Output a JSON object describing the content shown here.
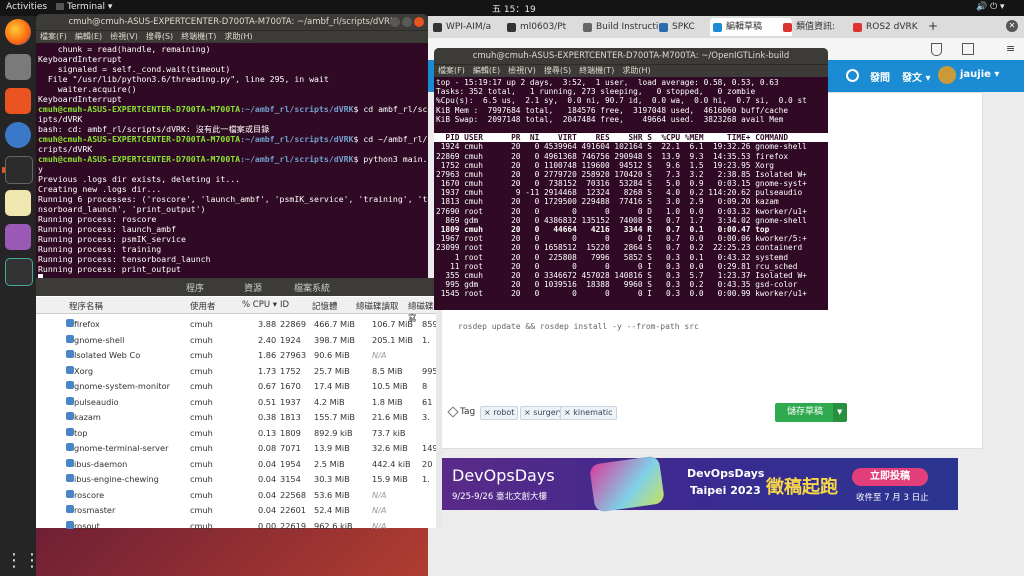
{
  "topbar": {
    "activities": "Activities",
    "app": "Terminal ▾",
    "clock": "五 15：19",
    "sys": "🔊 ⏻ ▾"
  },
  "dock": {
    "icons": [
      "firefox-icon",
      "files-icon",
      "software-icon",
      "help-icon",
      "terminal-icon",
      "editor-icon",
      "video-icon",
      "system-monitor-icon",
      "apps-grid-icon"
    ]
  },
  "browser": {
    "tabs": [
      "WPI-AIM/a",
      "ml0603/Pt",
      "Build Instructio",
      "SPKC",
      "編輯草稿",
      "類值資訊:",
      "ROS2 dVRK"
    ],
    "header": {
      "post": "發問",
      "publish": "發文 ▾",
      "user": "jaujie ▾"
    },
    "tags_label": "Tag",
    "tags": [
      "robot",
      "surgery",
      "kinematic"
    ],
    "save_label": "儲存草稿",
    "partial_text": "rosdep update && rosdep install -y --from-path src"
  },
  "banner": {
    "title": "DevOpsDays",
    "dates": "9/25-9/26 臺北文創大樓",
    "city": "DevOpsDays\nTaipei 2023",
    "city1": "DevOpsDays",
    "city2": "Taipei 2023",
    "cta": "徵稿起跑",
    "button": "立即投稿",
    "deadline": "收件至 7 月 3 日止"
  },
  "term1": {
    "title": "cmuh@cmuh-ASUS-EXPERTCENTER-D700TA-M700TA: ~/ambf_rl/scripts/dVRK",
    "menu": [
      "檔案(F)",
      "編輯(E)",
      "檢視(V)",
      "搜尋(S)",
      "終端機(T)",
      "求助(H)"
    ],
    "lines": [
      "    chunk = read(handle, remaining)",
      "KeyboardInterrupt",
      "    signaled = self._cond.wait(timeout)",
      "  File \"/usr/lib/python3.6/threading.py\", line 295, in wait",
      "    waiter.acquire()",
      "KeyboardInterrupt"
    ],
    "p1_user": "cmuh@cmuh-ASUS-EXPERTCENTER-D700TA-M700TA",
    "p1_path": ":~/ambf_rl/scripts/dVRK",
    "p1_cmd": "$ cd ambf_rl/scr",
    "p1_wrap": "ipts/dVRK",
    "err": "bash: cd: ambf_rl/scripts/dVRK: 沒有此一檔案或目錄",
    "p2_cmd": "$ cd ~/ambf_rl/s",
    "p2_wrap": "cripts/dVRK",
    "p3_cmd": "$ python3 main.p",
    "p3_wrap": "y",
    "out": [
      "Previous .logs dir exists, deleting it...",
      "Creating new .logs dir...",
      "Running 6 processes: ('roscore', 'launch_ambf', 'psmIK_service', 'training', 'te",
      "nsorboard_launch', 'print_output')",
      "Running process: roscore",
      "Running process: launch_ambf",
      "Running process: psmIK_service",
      "Running process: training",
      "Running process: tensorboard_launch",
      "Running process: print_output"
    ]
  },
  "term2": {
    "title": "cmuh@cmuh-ASUS-EXPERTCENTER-D700TA-M700TA: ~/OpenIGTLink-build",
    "menu": [
      "檔案(F)",
      "編輯(E)",
      "檢視(V)",
      "搜尋(S)",
      "終端機(T)",
      "求助(H)"
    ],
    "summary": [
      "top - 15:19:17 up 2 days,  3:52,  1 user,  load average: 0.58, 0.53, 0.63",
      "Tasks: 352 total,   1 running, 273 sleeping,   0 stopped,   0 zombie",
      "%Cpu(s):  6.5 us,  2.1 sy,  0.0 ni, 90.7 id,  0.0 wa,  0.0 hi,  0.7 si,  0.0 st",
      "KiB Mem :  7997684 total,   184576 free,  3197048 used,  4616060 buff/cache",
      "KiB Swap:  2097148 total,  2047484 free,    49664 used.  3823268 avail Mem"
    ],
    "header": "  PID USER      PR  NI    VIRT    RES    SHR S  %CPU %MEM     TIME+ COMMAND",
    "rows": [
      " 1924 cmuh      20   0 4539964 491604 102164 S  22.1  6.1  19:32.26 gnome-shell",
      "22869 cmuh      20   0 4961368 746756 290948 S  13.9  9.3  14:35.53 firefox",
      " 1752 cmuh      20   0 1100748 119600  94512 S   9.6  1.5  19:23.95 Xorg",
      "27963 cmuh      20   0 2779720 258920 170420 S   7.3  3.2   2:38.85 Isolated W+",
      " 1670 cmuh      20   0  738152  70316  53284 S   5.0  0.9   0:03.15 gnome-syst+",
      " 1937 cmuh       9 -11 2914468  12324   8268 S   4.0  0.2 114:20.62 pulseaudio",
      " 1813 cmuh      20   0 1729500 229488  77416 S   3.0  2.9   0:09.20 kazam",
      "27690 root      20   0       0      0      0 D   1.0  0.0   0:03.32 kworker/u1+",
      "  869 gdm       20   0 4386832 135152  74008 S   0.7  1.7   3:34.02 gnome-shell",
      " 1809 cmuh      20   0   44664   4216   3344 R   0.7  0.1   0:00.47 top",
      " 1967 root      20   0       0      0      0 I   0.7  0.0   0:00.06 kworker/5:+",
      "23099 root      20   0 1658512  15220   2864 S   0.7  0.2  22:25.23 containerd",
      "    1 root      20   0  225808   7996   5852 S   0.3  0.1   0:43.32 systemd",
      "   11 root      20   0       0      0      0 I   0.3  0.0   0:29.81 rcu_sched",
      "  355 cmuh      20   0 3346672 457028 140816 S   0.3  5.7   1:23.37 Isolated W+",
      "  995 gdm       20   0 1039516  18388   9960 S   0.3  0.2   0:43.35 gsd-color",
      " 1545 root      20   0       0      0      0 I   0.3  0.0   0:00.99 kworker/u1+"
    ],
    "bold_row_index": 9
  },
  "sysmon": {
    "tabs": [
      "程序",
      "資源",
      "檔案系統"
    ],
    "headers": [
      "程序名稱",
      "使用者",
      "% CPU ▾",
      "ID",
      "記憶體",
      "總磁碟讀取",
      "總磁碟寫"
    ],
    "rows": [
      {
        "name": "firefox",
        "user": "cmuh",
        "cpu": "3.88",
        "id": "22869",
        "mem": "466.7 MiB",
        "read": "106.7 MiB",
        "write": "859."
      },
      {
        "name": "gnome-shell",
        "user": "cmuh",
        "cpu": "2.40",
        "id": "1924",
        "mem": "398.7 MiB",
        "read": "205.1 MiB",
        "write": "1."
      },
      {
        "name": "Isolated Web Co",
        "user": "cmuh",
        "cpu": "1.86",
        "id": "27963",
        "mem": "90.6 MiB",
        "read": "N/A",
        "write": ""
      },
      {
        "name": "Xorg",
        "user": "cmuh",
        "cpu": "1.73",
        "id": "1752",
        "mem": "25.7 MiB",
        "read": "8.5 MiB",
        "write": "995"
      },
      {
        "name": "gnome-system-monitor",
        "user": "cmuh",
        "cpu": "0.67",
        "id": "1670",
        "mem": "17.4 MiB",
        "read": "10.5 MiB",
        "write": "8"
      },
      {
        "name": "pulseaudio",
        "user": "cmuh",
        "cpu": "0.51",
        "id": "1937",
        "mem": "4.2 MiB",
        "read": "1.8 MiB",
        "write": "61"
      },
      {
        "name": "kazam",
        "user": "cmuh",
        "cpu": "0.38",
        "id": "1813",
        "mem": "155.7 MiB",
        "read": "21.6 MiB",
        "write": "3."
      },
      {
        "name": "top",
        "user": "cmuh",
        "cpu": "0.13",
        "id": "1809",
        "mem": "892.9 kiB",
        "read": "73.7 kiB",
        "write": ""
      },
      {
        "name": "gnome-terminal-server",
        "user": "cmuh",
        "cpu": "0.08",
        "id": "7071",
        "mem": "13.9 MiB",
        "read": "32.6 MiB",
        "write": "149."
      },
      {
        "name": "ibus-daemon",
        "user": "cmuh",
        "cpu": "0.04",
        "id": "1954",
        "mem": "2.5 MiB",
        "read": "442.4 kiB",
        "write": "20"
      },
      {
        "name": "ibus-engine-chewing",
        "user": "cmuh",
        "cpu": "0.04",
        "id": "3154",
        "mem": "30.3 MiB",
        "read": "15.9 MiB",
        "write": "1."
      },
      {
        "name": "roscore",
        "user": "cmuh",
        "cpu": "0.04",
        "id": "22568",
        "mem": "53.6 MiB",
        "read": "N/A",
        "write": ""
      },
      {
        "name": "rosmaster",
        "user": "cmuh",
        "cpu": "0.04",
        "id": "22601",
        "mem": "52.4 MiB",
        "read": "N/A",
        "write": ""
      },
      {
        "name": "rosout",
        "user": "cmuh",
        "cpu": "0.00",
        "id": "22619",
        "mem": "962.6 kiB",
        "read": "N/A",
        "write": ""
      }
    ]
  }
}
